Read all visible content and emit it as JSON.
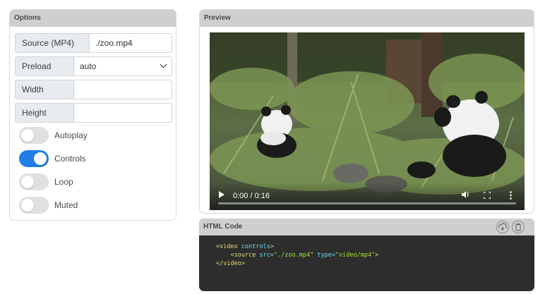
{
  "options": {
    "title": "Options",
    "source": {
      "label": "Source (MP4)",
      "value": "./zoo.mp4"
    },
    "preload": {
      "label": "Preload",
      "value": "auto"
    },
    "width": {
      "label": "Width",
      "value": ""
    },
    "height": {
      "label": "Height",
      "value": ""
    },
    "toggles": [
      {
        "label": "Autoplay",
        "on": false
      },
      {
        "label": "Controls",
        "on": true
      },
      {
        "label": "Loop",
        "on": false
      },
      {
        "label": "Muted",
        "on": false
      }
    ]
  },
  "preview": {
    "title": "Preview",
    "time": "0:00 / 0:16",
    "progress": 0
  },
  "code": {
    "title": "HTML Code",
    "icons": [
      "download-icon",
      "copy-icon"
    ],
    "line1_open": "<video",
    "line1_attr": " controls",
    "line1_close": ">",
    "line2_open": "<source",
    "line2_attr1": " src=",
    "line2_val1": "\"./zoo.mp4\"",
    "line2_attr2": " type=",
    "line2_val2": "\"video/mp4\"",
    "line2_close": ">",
    "line3": "</video>"
  },
  "colors": {
    "accent": "#1f7ee8",
    "header": "#cfcfcf",
    "code_bg": "#2d2d2d"
  }
}
